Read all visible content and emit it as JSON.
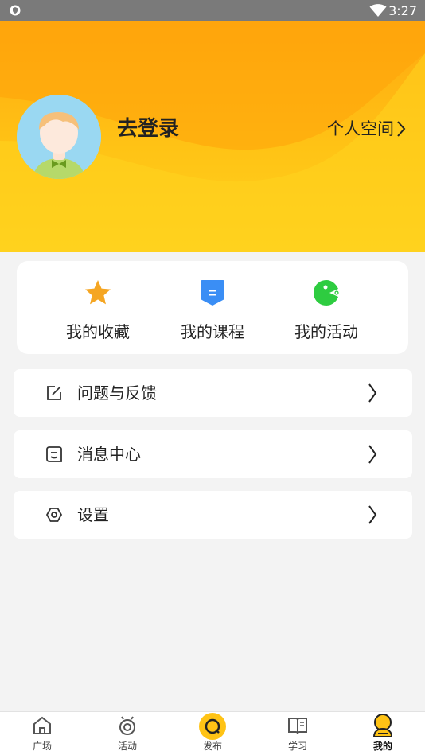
{
  "status_bar": {
    "time": "3:27"
  },
  "profile": {
    "login_label": "去登录",
    "space_link": "个人空间"
  },
  "quick_actions": [
    {
      "label": "我的收藏",
      "icon": "star-icon",
      "color": "#f5a623"
    },
    {
      "label": "我的课程",
      "icon": "course-icon",
      "color": "#3a8ef5"
    },
    {
      "label": "我的活动",
      "icon": "activity-icon",
      "color": "#2ecc40"
    }
  ],
  "menu": [
    {
      "label": "问题与反馈",
      "icon": "edit-icon"
    },
    {
      "label": "消息中心",
      "icon": "message-icon"
    },
    {
      "label": "设置",
      "icon": "settings-icon"
    }
  ],
  "bottom_nav": [
    {
      "label": "广场",
      "icon": "home-icon"
    },
    {
      "label": "活动",
      "icon": "activity-nav-icon"
    },
    {
      "label": "发布",
      "icon": "publish-icon"
    },
    {
      "label": "学习",
      "icon": "book-icon"
    },
    {
      "label": "我的",
      "icon": "profile-icon",
      "active": true
    }
  ],
  "colors": {
    "accent": "#ffc315",
    "header_top": "#ffa810",
    "background": "#f3f3f3"
  }
}
